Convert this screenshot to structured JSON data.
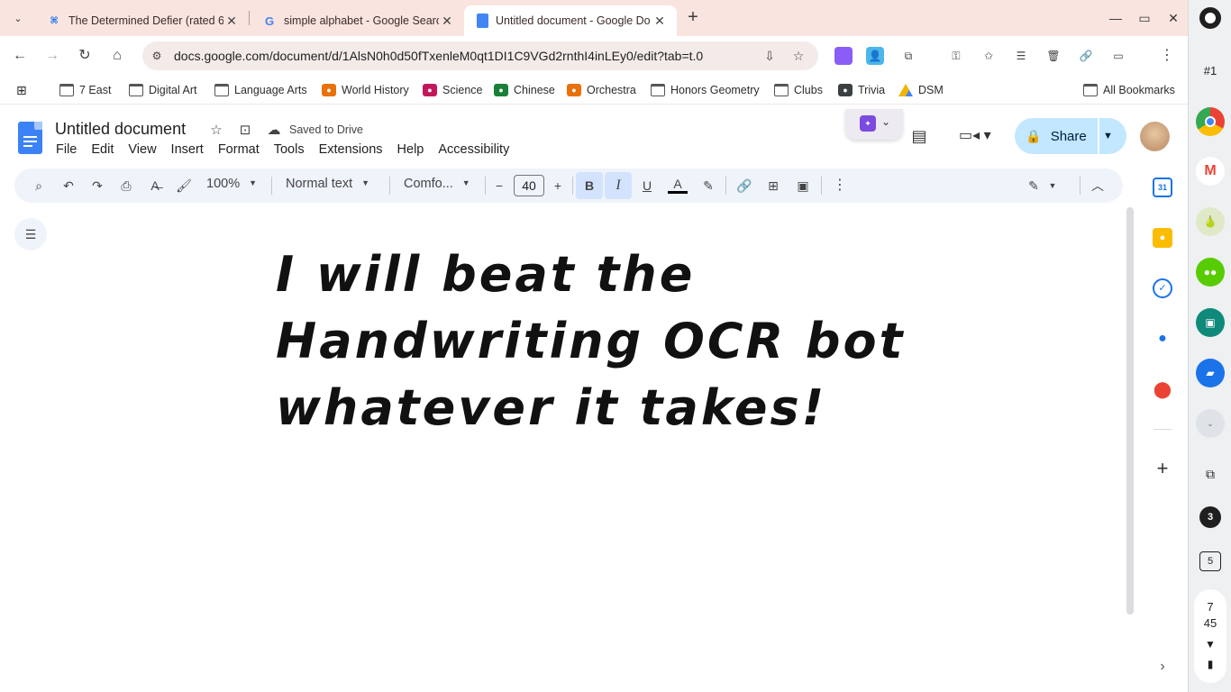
{
  "tabs": [
    {
      "title": "The Determined Defier (rated 6",
      "favicon": "puzzle-favicon",
      "close": "✕"
    },
    {
      "title": "simple alphabet - Google Searc",
      "favicon": "google-favicon",
      "close": "✕"
    },
    {
      "title": "Untitled document - Google Do",
      "favicon": "docs-favicon",
      "close": "✕",
      "active": true
    }
  ],
  "window_controls": {
    "minimize": "—",
    "restore": "▭",
    "close": "✕"
  },
  "toolbar": {
    "url": "docs.google.com/document/d/1AlsN0h0d50fTxenleM0qt1DI1C9VGd2rnthI4inLEy0/edit?tab=t.0"
  },
  "bookmarks": [
    {
      "label": "7 East",
      "icon": "folder"
    },
    {
      "label": "Digital Art",
      "icon": "folder"
    },
    {
      "label": "Language Arts",
      "icon": "folder"
    },
    {
      "label": "World History",
      "icon": "classroom",
      "color": "#e8710a"
    },
    {
      "label": "Science",
      "icon": "classroom",
      "color": "#c2185b"
    },
    {
      "label": "Chinese",
      "icon": "classroom",
      "color": "#188038"
    },
    {
      "label": "Orchestra",
      "icon": "classroom",
      "color": "#e8710a"
    },
    {
      "label": "Honors Geometry",
      "icon": "folder"
    },
    {
      "label": "Clubs",
      "icon": "folder"
    },
    {
      "label": "Trivia",
      "icon": "classroom",
      "color": "#3c4043"
    },
    {
      "label": "DSM",
      "icon": "drive"
    }
  ],
  "all_bookmarks": "All Bookmarks",
  "docs": {
    "title": "Untitled document",
    "saved_status": "Saved to Drive",
    "menu": [
      "File",
      "Edit",
      "View",
      "Insert",
      "Format",
      "Tools",
      "Extensions",
      "Help",
      "Accessibility"
    ],
    "share_label": "Share",
    "zoom": "100%",
    "style": "Normal text",
    "font": "Comfo...",
    "font_size": "40",
    "body_lines": [
      "I will beat the",
      "Handwriting OCR bot",
      "whatever it takes!"
    ]
  },
  "shelf": {
    "desk_label": "#1",
    "notif_count": "3",
    "calendar_day": "5",
    "time_hour": "7",
    "time_min": "45"
  },
  "colors": {
    "tab_strip": "#f9e4e0",
    "share_bg": "#c2e7ff",
    "toolbar_bg": "#eff3fa",
    "active_toggle": "#d3e3fd"
  }
}
